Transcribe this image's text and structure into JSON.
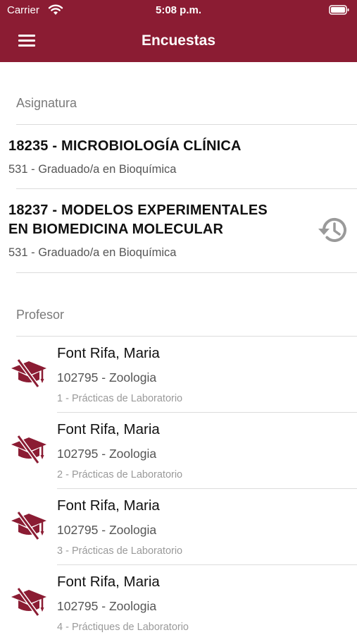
{
  "status_bar": {
    "carrier": "Carrier",
    "time": "5:08 p.m."
  },
  "navbar": {
    "title": "Encuestas"
  },
  "colors": {
    "brand": "#8b1c33",
    "section_text": "#7a7a7a",
    "icon_gray": "#9a9a9a"
  },
  "sections": {
    "subjects_header": "Asignatura",
    "teachers_header": "Profesor"
  },
  "subjects": [
    {
      "title_line1": "18235 - MICROBIOLOGÍA CLÍNICA",
      "title_line2": "",
      "subtitle": "531 - Graduado/a en Bioquímica",
      "icon": ""
    },
    {
      "title_line1": "18237 - MODELOS EXPERIMENTALES",
      "title_line2": "EN BIOMEDICINA MOLECULAR",
      "subtitle": "531 - Graduado/a en Bioquímica",
      "icon": "history-icon"
    }
  ],
  "teachers": [
    {
      "name": "Font Rifa, Maria",
      "department": "102795 - Zoologia",
      "group": "1 - Prácticas de Laboratorio",
      "icon": "graduation-cap-crossed-icon"
    },
    {
      "name": "Font Rifa, Maria",
      "department": "102795 - Zoologia",
      "group": "2 - Prácticas de Laboratorio",
      "icon": "graduation-cap-crossed-icon"
    },
    {
      "name": "Font Rifa, Maria",
      "department": "102795 - Zoologia",
      "group": "3 - Prácticas de Laboratorio",
      "icon": "graduation-cap-crossed-icon"
    },
    {
      "name": "Font Rifa, Maria",
      "department": "102795 - Zoologia",
      "group": "4 - Práctiques de Laboratorio",
      "icon": "graduation-cap-crossed-icon"
    }
  ]
}
